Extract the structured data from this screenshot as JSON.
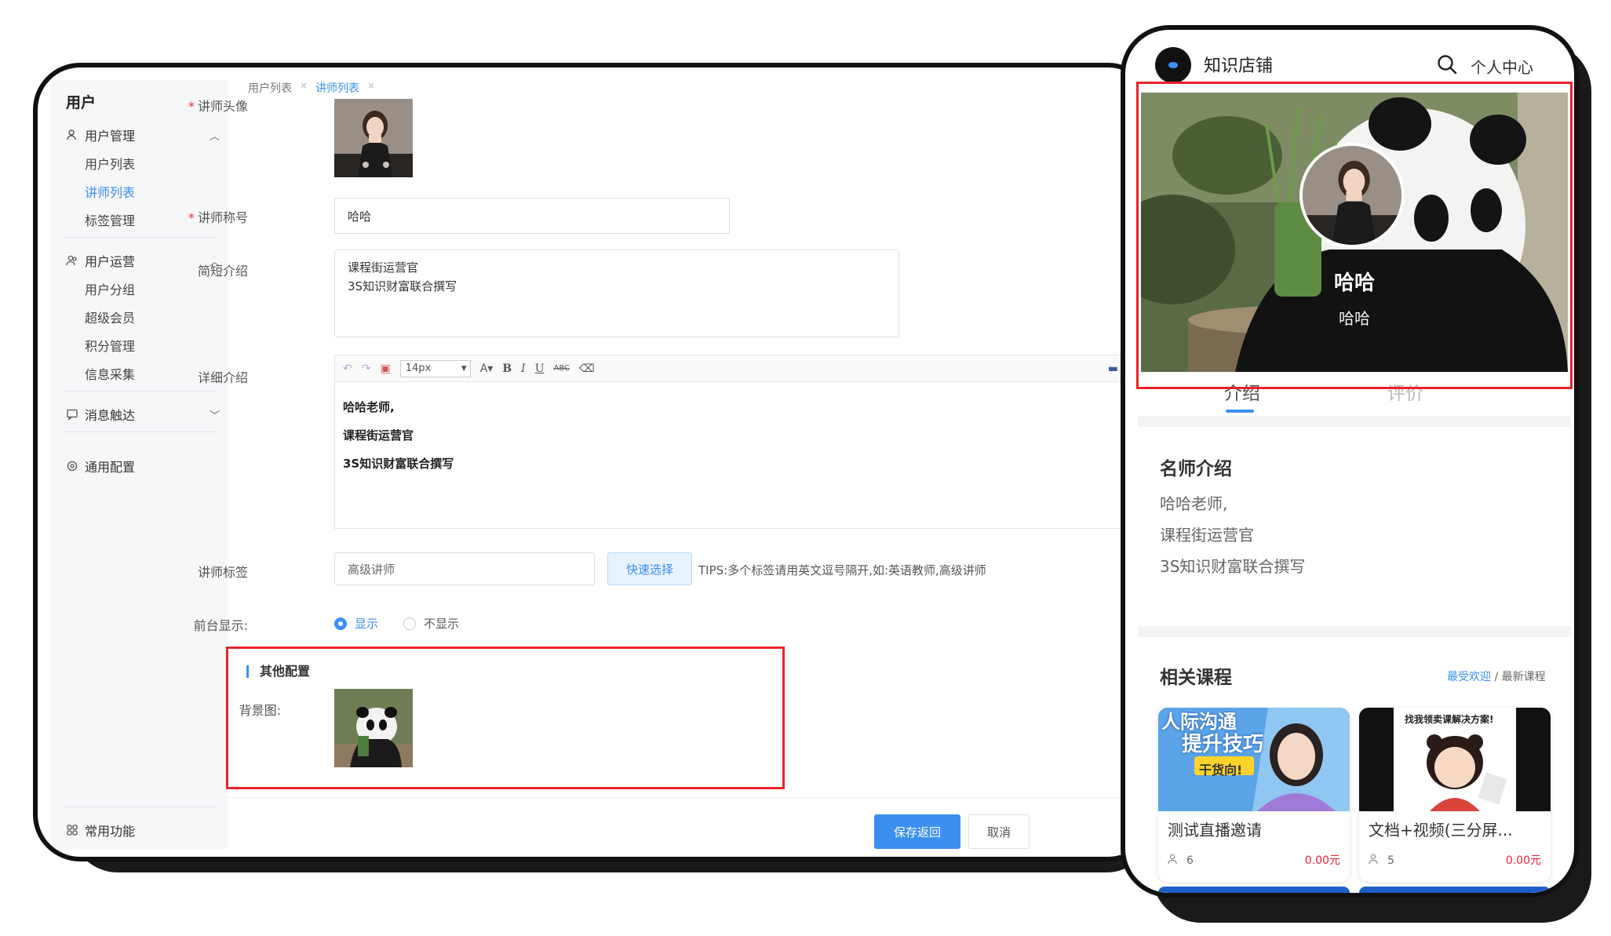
{
  "admin": {
    "sidebar": {
      "title": "用户",
      "groups": [
        {
          "label": "用户管理",
          "icon": "user-icon",
          "expanded": true,
          "items": [
            {
              "label": "用户列表"
            },
            {
              "label": "讲师列表",
              "active": true
            },
            {
              "label": "标签管理"
            }
          ]
        },
        {
          "label": "用户运营",
          "icon": "users-icon",
          "expanded": true,
          "items": [
            {
              "label": "用户分组"
            },
            {
              "label": "超级会员"
            },
            {
              "label": "积分管理"
            },
            {
              "label": "信息采集"
            }
          ]
        },
        {
          "label": "消息触达",
          "icon": "message-icon",
          "expanded": false,
          "items": []
        },
        {
          "label": "通用配置",
          "icon": "gear-icon",
          "items": []
        }
      ],
      "bottom": {
        "label": "常用功能",
        "icon": "grid-icon"
      }
    },
    "breadcrumb": {
      "items": [
        "用户列表",
        "讲师列表"
      ]
    },
    "form": {
      "avatar_label": "讲师头像",
      "name_label": "讲师称号",
      "name_value": "哈哈",
      "brief_label": "简短介绍",
      "brief_value": [
        "课程街运营官",
        "3S知识财富联合撰写"
      ],
      "detail_label": "详细介绍",
      "editor": {
        "font_size": "14px",
        "content": [
          "哈哈老师,",
          "课程街运营官",
          "3S知识财富联合撰写"
        ]
      },
      "tag_label": "讲师标签",
      "tag_value": "高级讲师",
      "quick_select": "快速选择",
      "tips": "TIPS:多个标签请用英文逗号隔开,如:英语教师,高级讲师",
      "display_label": "前台显示:",
      "display_options": {
        "show": "显示",
        "hide": "不显示",
        "selected": "show"
      },
      "other_section": "其他配置",
      "bg_label": "背景图:"
    },
    "footer": {
      "save": "保存返回",
      "cancel": "取消"
    }
  },
  "phone": {
    "shop_title": "知识店铺",
    "user_center": "个人中心",
    "hero": {
      "name": "哈哈",
      "subtitle": "哈哈"
    },
    "tabs": [
      "介绍",
      "评价"
    ],
    "intro": {
      "title": "名师介绍",
      "lines": [
        "哈哈老师,",
        "课程街运营官",
        "3S知识财富联合撰写"
      ]
    },
    "courses": {
      "title": "相关课程",
      "sort_popular": "最受欢迎",
      "sort_sep": " / ",
      "sort_latest": "最新课程",
      "items": [
        {
          "name": "测试直播邀请",
          "count": "6",
          "price": "0.00元",
          "cover_text": [
            "人际沟通",
            "提升技巧",
            "干货向!"
          ]
        },
        {
          "name": "文档+视频(三分屏...",
          "count": "5",
          "price": "0.00元",
          "cover_text": [
            "找我领卖课解决方案!"
          ]
        }
      ]
    }
  },
  "colors": {
    "accent": "#3b8ff0",
    "highlight_box": "#e8242a",
    "price": "#e22233"
  }
}
